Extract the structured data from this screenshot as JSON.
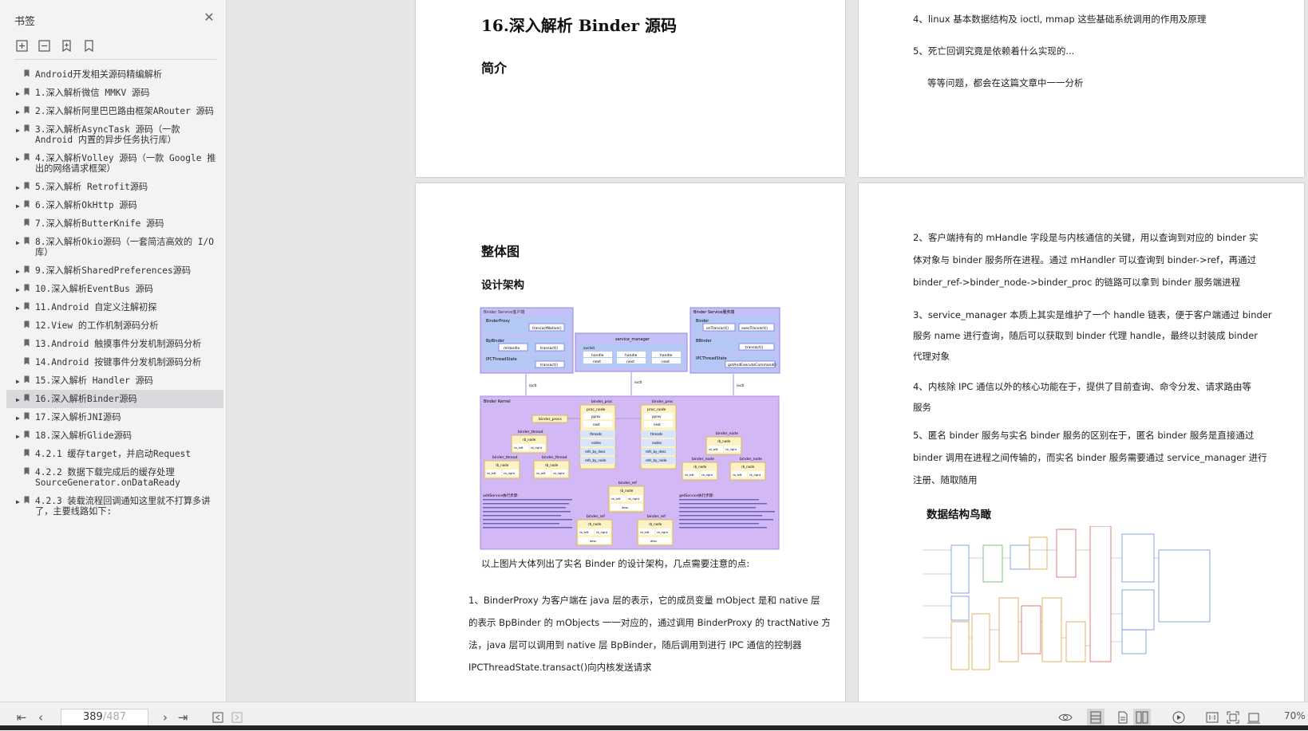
{
  "sidebar": {
    "title": "书签",
    "bookmarks": [
      {
        "label": "Android开发相关源码精编解析",
        "expandable": false
      },
      {
        "label": "1.深入解析微信 MMKV 源码",
        "expandable": true
      },
      {
        "label": "2.深入解析阿里巴巴路由框架ARouter 源码",
        "expandable": true
      },
      {
        "label": "3.深入解析AsyncTask 源码（一款 Android 内置的异步任务执行库）",
        "expandable": true
      },
      {
        "label": "4.深入解析Volley 源码（一款 Google 推出的网络请求框架）",
        "expandable": true
      },
      {
        "label": "5.深入解析 Retrofit源码",
        "expandable": true
      },
      {
        "label": "6.深入解析OkHttp 源码",
        "expandable": true
      },
      {
        "label": "7.深入解析ButterKnife 源码",
        "expandable": false
      },
      {
        "label": "8.深入解析Okio源码（一套简洁高效的 I/O 库）",
        "expandable": true
      },
      {
        "label": "9.深入解析SharedPreferences源码",
        "expandable": true
      },
      {
        "label": "10.深入解析EventBus 源码",
        "expandable": true
      },
      {
        "label": "11.Android 自定义注解初探",
        "expandable": true
      },
      {
        "label": "12.View 的工作机制源码分析",
        "expandable": false
      },
      {
        "label": "13.Android 触摸事件分发机制源码分析",
        "expandable": false
      },
      {
        "label": "14.Android 按键事件分发机制源码分析",
        "expandable": false
      },
      {
        "label": "15.深入解析  Handler 源码",
        "expandable": true
      },
      {
        "label": "16.深入解析Binder源码",
        "expandable": true,
        "active": true
      },
      {
        "label": "17.深入解析JNI源码",
        "expandable": true
      },
      {
        "label": "18.深入解析Glide源码",
        "expandable": true
      },
      {
        "label": "4.2.1 缓存target，并启动Request",
        "expandable": false
      },
      {
        "label": "4.2.2 数据下载完成后的缓存处理SourceGenerator.onDataReady",
        "expandable": false
      },
      {
        "label": "4.2.3 装载流程回调通知这里就不打算多讲了，主要线路如下:",
        "expandable": true
      }
    ]
  },
  "page1_left": {
    "heading": "16.深入解析 Binder 源码",
    "subheading": "简介"
  },
  "page1_right": {
    "item4": "4、linux 基本数据结构及 ioctl, mmap 这些基础系统调用的作用及原理",
    "item5": "5、死亡回调究竟是依赖着什么实现的...",
    "note": "等等问题，都会在这篇文章中一一分析"
  },
  "page2_left": {
    "heading": "整体图",
    "subheading": "设计架构",
    "caption": "以上图片大体列出了实名 Binder 的设计架构，几点需要注意的点:",
    "para1_lines": [
      "1、BinderProxy 为客户端在 java 层的表示，它的成员变量 mObject 是和 native 层",
      "的表示 BpBinder 的 mObjects 一一对应的，通过调用 BinderProxy 的 tractNative 方",
      "法，java 层可以调用到 native 层 BpBinder，随后调用到进行 IPC 通信的控制器",
      "IPCThreadState.transact()向内核发送请求"
    ],
    "diagram": {
      "client_box": "Binder Service客户端",
      "binder_proxy": "BinderProxy",
      "transact_native": "transactNative()",
      "bp_binder": "BpBinder",
      "m_handle": "mHandle",
      "transact": "transact()",
      "ipc_thread_state": "IPCThreadState",
      "service_manager": "service_manager",
      "svclist": "svclist",
      "handle": "handle",
      "next": "next",
      "server_box": "Binder Service服务端",
      "binder": "Binder",
      "on_transact": "onTransact()",
      "exec_transact": "execTransact()",
      "b_binder": "BBinder",
      "get_and_execute": "getAndExecuteCommand()",
      "ioctl": "ioctl",
      "kernel": "Binder Kernel",
      "binder_proc": "binder_proc",
      "proc_node": "proc_node",
      "pprev": "pprev",
      "threads": "threads",
      "nodes": "nodes",
      "refs_by_desc": "refs_by_desc",
      "refs_by_node": "refs_by_node",
      "binder_procs": "binder_procs",
      "binder_thread": "binder_thread",
      "binder_node": "binder_node",
      "binder_ref": "binder_ref",
      "rb_node": "rb_node",
      "rb_left": "rb_left",
      "rb_right": "rb_right",
      "desc": "desc",
      "add_service_title": "addService执行步骤:",
      "get_service_title": "getService执行步骤:"
    }
  },
  "page2_right": {
    "para2_lines": [
      "2、客户端持有的 mHandle 字段是与内核通信的关键，用以查询到对应的 binder 实",
      "体对象与 binder 服务所在进程。通过 mHandler 可以查询到 binder->ref，再通过",
      "binder_ref->binder_node->binder_proc 的链路可以拿到 binder 服务端进程"
    ],
    "para3_lines": [
      "3、service_manager 本质上其实是维护了一个 handle 链表，便于客户端通过 binder",
      "服务 name 进行查询，随后可以获取到 binder 代理 handle，最终以封装成 binder",
      "代理对象"
    ],
    "para4_lines": [
      "4、内核除 IPC 通信以外的核心功能在于，提供了目前查询、命令分发、请求路由等",
      "服务"
    ],
    "para5_lines": [
      "5、匿名 binder 服务与实名 binder 服务的区别在于，匿名 binder 服务是直接通过",
      "binder 调用在进程之间传输的，而实名 binder 服务需要通过 service_manager 进行",
      "注册、随取随用"
    ],
    "section_title": "数据结构鸟瞰"
  },
  "bottombar": {
    "current_page": "389",
    "total_pages": "/487",
    "zoom": "70%"
  }
}
